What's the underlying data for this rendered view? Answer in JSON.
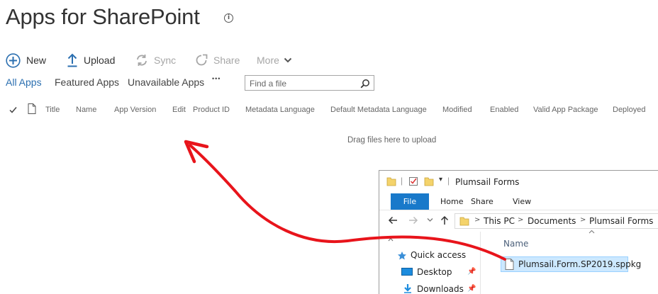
{
  "page": {
    "title": "Apps for SharePoint",
    "info_icon": "info-icon"
  },
  "commands": {
    "new": "New",
    "upload": "Upload",
    "sync": "Sync",
    "share": "Share",
    "more": "More"
  },
  "tabs": [
    "All Apps",
    "Featured Apps",
    "Unavailable Apps"
  ],
  "tabs_more": "•••",
  "search": {
    "placeholder": "Find a file"
  },
  "columns": [
    "Title",
    "Name",
    "App Version",
    "Edit",
    "Product ID",
    "Metadata Language",
    "Default Metadata Language",
    "Modified",
    "Enabled",
    "Valid App Package",
    "Deployed"
  ],
  "drop_hint": "Drag files here to upload",
  "explorer": {
    "title": "Plumsail Forms",
    "ribbon": {
      "file": "File",
      "home": "Home",
      "share": "Share",
      "view": "View"
    },
    "breadcrumbs": [
      "This PC",
      "Documents",
      "Plumsail Forms"
    ],
    "nav": [
      {
        "label": "Quick access",
        "icon": "star-icon"
      },
      {
        "label": "Desktop",
        "icon": "desktop-icon"
      },
      {
        "label": "Downloads",
        "icon": "download-icon"
      }
    ],
    "column_header": "Name",
    "files": [
      "Plumsail.Form.SP2019.sppkg"
    ]
  },
  "colors": {
    "accent": "#2b6fb0",
    "arrow": "#e8141b",
    "file_tab": "#1979ca",
    "selection": "#cce8ff"
  }
}
